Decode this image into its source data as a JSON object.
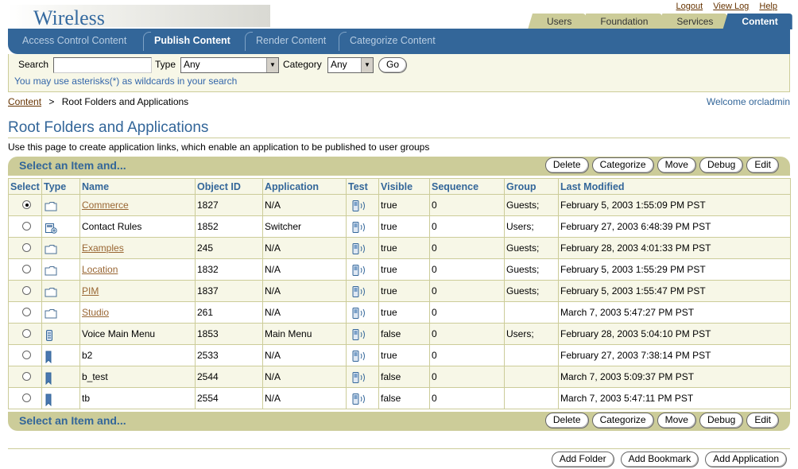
{
  "app": {
    "title": "Wireless"
  },
  "global_links": [
    "Logout",
    "View Log",
    "Help"
  ],
  "tabs": [
    "Users",
    "Foundation",
    "Services",
    "Content"
  ],
  "subnav": [
    "Access Control Content",
    "Publish Content",
    "Render Content",
    "Categorize Content"
  ],
  "search": {
    "label": "Search",
    "value": "",
    "type_label": "Type",
    "type_value": "Any",
    "category_label": "Category",
    "category_value": "Any",
    "go_label": "Go",
    "hint": "You may use asterisks(*) as wildcards in your search"
  },
  "breadcrumb": {
    "parent": "Content",
    "separator": ">",
    "current": "Root Folders and Applications"
  },
  "welcome": "Welcome orcladmin",
  "page": {
    "title": "Root Folders and Applications",
    "description": "Use this page to create application links, which enable an application to be published to user groups"
  },
  "actions": {
    "label": "Select an Item and...",
    "buttons": [
      "Delete",
      "Categorize",
      "Move",
      "Debug",
      "Edit"
    ]
  },
  "table": {
    "columns": [
      "Select",
      "Type",
      "Name",
      "Object ID",
      "Application",
      "Test",
      "Visible",
      "Sequence",
      "Group",
      "Last Modified"
    ],
    "rows": [
      {
        "selected": true,
        "type_icon": "folder-icon",
        "name": "Commerce",
        "link": true,
        "id": "1827",
        "app": "N/A",
        "visible": "true",
        "seq": "0",
        "group": "Guests;",
        "modified": "February 5, 2003 1:55:09 PM PST"
      },
      {
        "selected": false,
        "type_icon": "application-icon",
        "name": "Contact Rules",
        "link": false,
        "id": "1852",
        "app": "Switcher",
        "visible": "true",
        "seq": "0",
        "group": "Users;",
        "modified": "February 27, 2003 6:48:39 PM PST"
      },
      {
        "selected": false,
        "type_icon": "folder-icon",
        "name": "Examples",
        "link": true,
        "id": "245",
        "app": "N/A",
        "visible": "true",
        "seq": "0",
        "group": "Guests;",
        "modified": "February 28, 2003 4:01:33 PM PST"
      },
      {
        "selected": false,
        "type_icon": "folder-icon",
        "name": "Location",
        "link": true,
        "id": "1832",
        "app": "N/A",
        "visible": "true",
        "seq": "0",
        "group": "Guests;",
        "modified": "February 5, 2003 1:55:29 PM PST"
      },
      {
        "selected": false,
        "type_icon": "folder-icon",
        "name": "PIM",
        "link": true,
        "id": "1837",
        "app": "N/A",
        "visible": "true",
        "seq": "0",
        "group": "Guests;",
        "modified": "February 5, 2003 1:55:47 PM PST"
      },
      {
        "selected": false,
        "type_icon": "folder-icon",
        "name": "Studio",
        "link": true,
        "id": "261",
        "app": "N/A",
        "visible": "true",
        "seq": "0",
        "group": "",
        "modified": "March 7, 2003 5:47:27 PM PST"
      },
      {
        "selected": false,
        "type_icon": "voice-app-icon",
        "name": "Voice Main Menu",
        "link": false,
        "id": "1853",
        "app": "Main Menu",
        "visible": "false",
        "seq": "0",
        "group": "Users;",
        "modified": "February 28, 2003 5:04:10 PM PST"
      },
      {
        "selected": false,
        "type_icon": "bookmark-icon",
        "name": "b2",
        "link": false,
        "id": "2533",
        "app": "N/A",
        "visible": "true",
        "seq": "0",
        "group": "",
        "modified": "February 27, 2003 7:38:14 PM PST"
      },
      {
        "selected": false,
        "type_icon": "bookmark-icon",
        "name": "b_test",
        "link": false,
        "id": "2544",
        "app": "N/A",
        "visible": "false",
        "seq": "0",
        "group": "",
        "modified": "March 7, 2003 5:09:37 PM PST"
      },
      {
        "selected": false,
        "type_icon": "bookmark-icon",
        "name": "tb",
        "link": false,
        "id": "2554",
        "app": "N/A",
        "visible": "false",
        "seq": "0",
        "group": "",
        "modified": "March 7, 2003 5:47:11 PM PST"
      }
    ]
  },
  "page_buttons": [
    "Add Folder",
    "Add Bookmark",
    "Add Application"
  ],
  "colors": {
    "brand_blue": "#336699",
    "tan": "#cccc99",
    "link_brown": "#996633"
  }
}
